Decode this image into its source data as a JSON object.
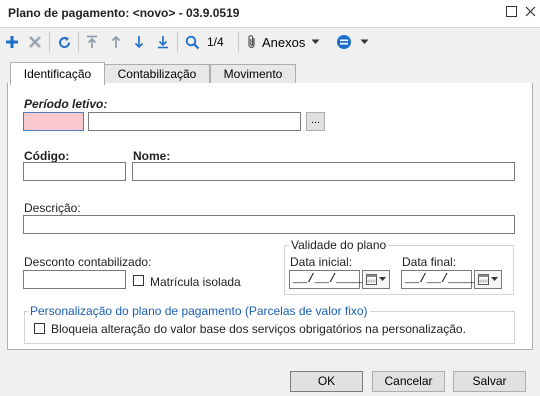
{
  "window": {
    "title": "Plano de pagamento: <novo> - 03.9.0519"
  },
  "toolbar": {
    "record_position": "1/4",
    "attachments_label": "Anexos"
  },
  "tabs": [
    {
      "label": "Identificação",
      "active": true
    },
    {
      "label": "Contabilização",
      "active": false
    },
    {
      "label": "Movimento",
      "active": false
    }
  ],
  "form": {
    "periodo_letivo_label": "Período letivo:",
    "periodo_code_value": "",
    "periodo_desc_value": "",
    "lookup_button_label": "...",
    "codigo_label": "Código:",
    "codigo_value": "",
    "nome_label": "Nome:",
    "nome_value": "",
    "descricao_label": "Descrição:",
    "descricao_value": "",
    "desconto_label": "Desconto contabilizado:",
    "desconto_value": "",
    "matricula_isolada_label": "Matrícula isolada",
    "validade_group_label": "Validade do plano",
    "data_inicial_label": "Data inicial:",
    "data_inicial_value": "__/__/____",
    "data_final_label": "Data final:",
    "data_final_value": "__/__/____",
    "personalizacao_group_label": "Personalização do plano de pagamento (Parcelas de valor fixo)",
    "bloqueia_label": "Bloqueia alteração do valor base dos serviços obrigatórios na personalização."
  },
  "buttons": {
    "ok": "OK",
    "cancel": "Cancelar",
    "save": "Salvar"
  },
  "colors": {
    "accent_blue": "#1e6fc9",
    "required_field_bg": "#f8c8cc",
    "group_legend_blue": "#1a5fb4"
  }
}
